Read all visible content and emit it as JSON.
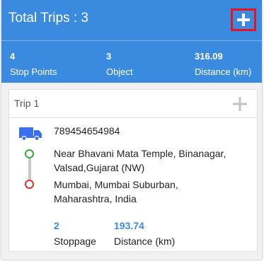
{
  "header": {
    "title": "Total Trips : 3",
    "add_icon": "plus-icon"
  },
  "stats": [
    {
      "value": "4",
      "label": "Stop Points"
    },
    {
      "value": "3",
      "label": "Object"
    },
    {
      "value": "316.09",
      "label": "Distance (km)"
    }
  ],
  "trip": {
    "label": "Trip 1",
    "add_icon": "plus-icon",
    "vehicle_icon": "truck-icon",
    "vehicle_number": "789454654984",
    "start_address": "Near Bhavani Mata Temple, Binanagar, Valsad,Gujarat (NW)",
    "end_address": "Mumbai, Mumbai Suburban, Maharashtra, India",
    "stoppage_value": "2",
    "stoppage_label": "Stoppage",
    "distance_value": "193.74",
    "distance_label": "Distance (km)"
  },
  "colors": {
    "primary": "#3a8ae0",
    "highlight": "#e8131f",
    "start": "#3aa83a",
    "end": "#e0302f"
  }
}
